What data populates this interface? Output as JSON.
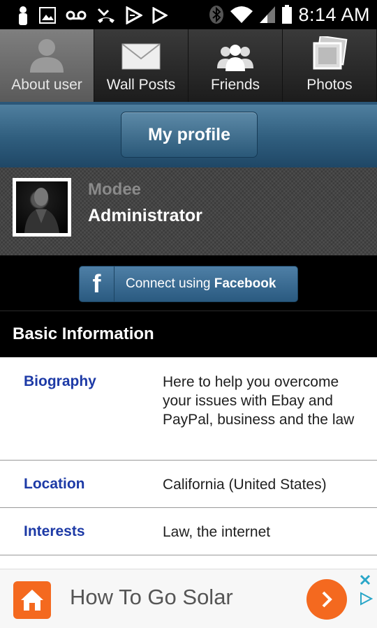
{
  "status_bar": {
    "time": "8:14 AM",
    "icons": [
      "person-icon",
      "image-icon",
      "voicemail-icon",
      "missed-call-icon",
      "play-store-icon",
      "play-icon",
      "bluetooth-icon",
      "wifi-icon",
      "signal-icon",
      "battery-icon"
    ]
  },
  "tabs": [
    {
      "label": "About user",
      "icon": "user-silhouette-icon",
      "active": true
    },
    {
      "label": "Wall Posts",
      "icon": "envelope-icon",
      "active": false
    },
    {
      "label": "Friends",
      "icon": "friends-icon",
      "active": false
    },
    {
      "label": "Photos",
      "icon": "photos-icon",
      "active": false
    }
  ],
  "header": {
    "button_label": "My profile"
  },
  "user": {
    "name": "Modee",
    "role": "Administrator"
  },
  "facebook": {
    "prefix": "Connect using ",
    "brand": "Facebook",
    "logo_letter": "f"
  },
  "section": {
    "title": "Basic Information"
  },
  "info_rows": [
    {
      "key": "Biography",
      "value": "Here to help you overcome your issues with Ebay and PayPal, business and the law"
    },
    {
      "key": "Location",
      "value": "California (United States)"
    },
    {
      "key": "Interests",
      "value": "Law, the internet"
    }
  ],
  "ad": {
    "text": "How To Go Solar",
    "accent": "#f4691f"
  },
  "colors": {
    "link_blue": "#1d3aa6",
    "header_blue": "#2f5d7d"
  }
}
